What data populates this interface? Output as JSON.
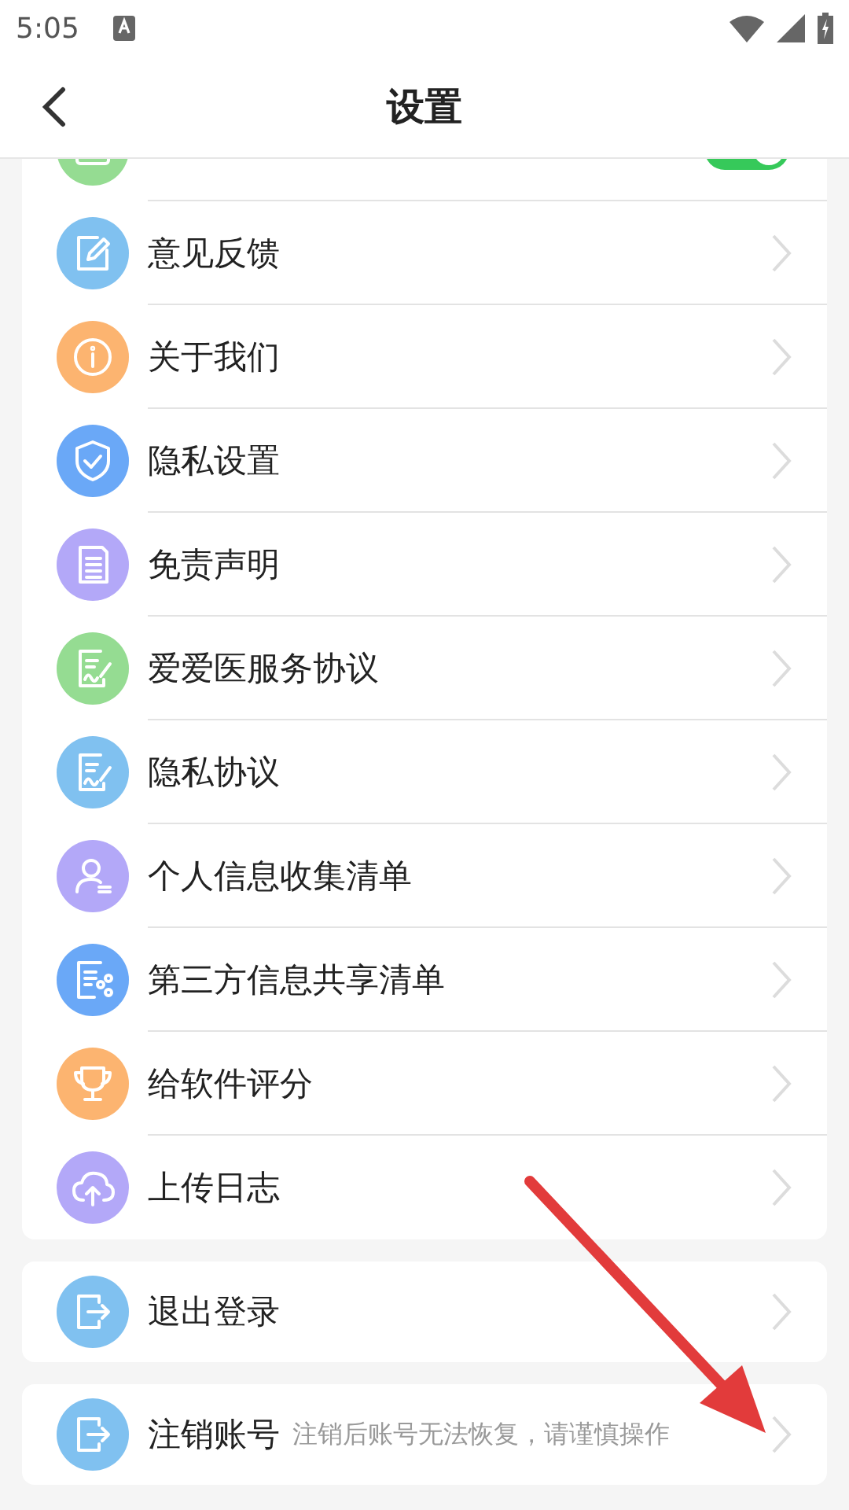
{
  "status_bar": {
    "time": "5:05"
  },
  "header": {
    "title": "设置"
  },
  "groups": [
    {
      "items": [
        {
          "kind": "toggle",
          "on": true,
          "color": "#95dc92"
        },
        {
          "kind": "link",
          "label": "意见反馈",
          "color": "#80c1f0"
        },
        {
          "kind": "link",
          "label": "关于我们",
          "color": "#fcb470"
        },
        {
          "kind": "link",
          "label": "隐私设置",
          "color": "#6aa8f7"
        },
        {
          "kind": "link",
          "label": "免责声明",
          "color": "#b3a8f8"
        },
        {
          "kind": "link",
          "label": "爱爱医服务协议",
          "color": "#95dc92"
        },
        {
          "kind": "link",
          "label": "隐私协议",
          "color": "#80c1f0"
        },
        {
          "kind": "link",
          "label": "个人信息收集清单",
          "color": "#b3a8f8"
        },
        {
          "kind": "link",
          "label": "第三方信息共享清单",
          "color": "#6aa8f7"
        },
        {
          "kind": "link",
          "label": "给软件评分",
          "color": "#fcb470"
        },
        {
          "kind": "link",
          "label": "上传日志",
          "color": "#b3a8f8"
        }
      ]
    },
    {
      "items": [
        {
          "kind": "link",
          "label": "退出登录",
          "color": "#80c1f0"
        }
      ]
    },
    {
      "items": [
        {
          "kind": "link",
          "label": "注销账号",
          "note": "注销后账号无法恢复，请谨慎操作",
          "color": "#80c1f0"
        }
      ]
    }
  ],
  "annotation": {
    "kind": "arrow"
  }
}
